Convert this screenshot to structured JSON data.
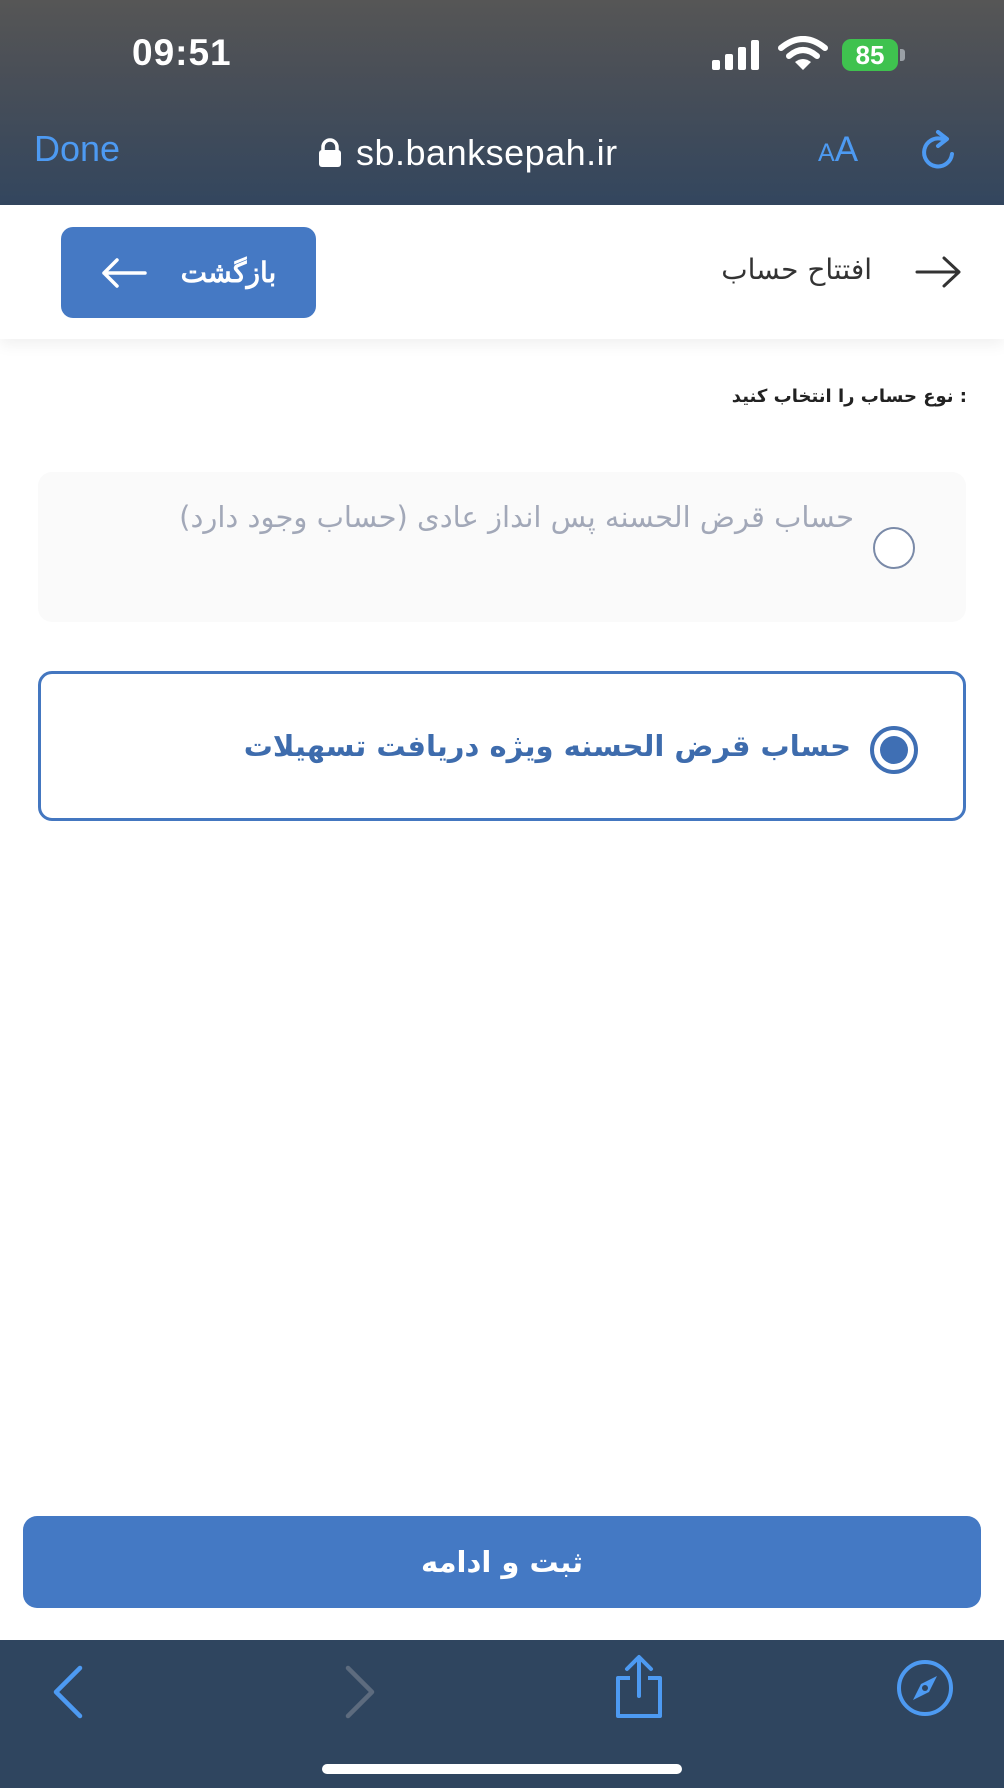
{
  "status_bar": {
    "time": "09:51",
    "battery": "85",
    "icons": [
      "signal-icon",
      "wifi-icon",
      "battery-charging-icon"
    ]
  },
  "browser": {
    "done_label": "Done",
    "url": "sb.banksepah.ir",
    "text_size_small": "A",
    "text_size_big": "A",
    "icons": [
      "lock-icon",
      "reload-icon"
    ],
    "accent_color": "#4d9af2"
  },
  "header": {
    "back_label": "بازگشت",
    "title": "افتتاح حساب",
    "icons": [
      "arrow-left-icon",
      "arrow-right-icon"
    ]
  },
  "form": {
    "prompt": "نوع حساب را انتخاب کنید :",
    "options": [
      {
        "label": "حساب قرض الحسنه پس انداز عادی (حساب وجود دارد)",
        "selected": false,
        "disabled": true
      },
      {
        "label": "حساب قرض الحسنه ویژه دریافت تسهیلات",
        "selected": true,
        "disabled": false
      }
    ],
    "submit_label": "ثبت و ادامه",
    "primary_color": "#4479c4"
  },
  "toolbar": {
    "icons": [
      "back-chevron-icon",
      "forward-chevron-icon",
      "share-icon",
      "compass-icon"
    ]
  }
}
